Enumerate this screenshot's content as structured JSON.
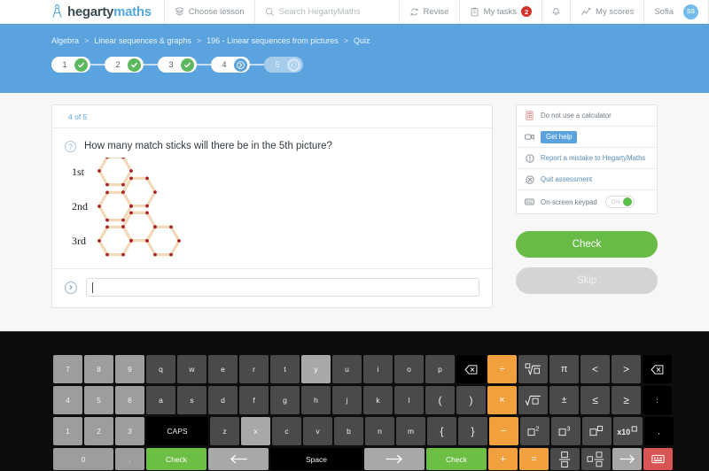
{
  "nav": {
    "logo_dark": "hegarty",
    "logo_blue": "maths",
    "choose_lesson": "Choose lesson",
    "search_placeholder": "Search HegartyMaths",
    "revise": "Revise",
    "my_tasks": "My tasks",
    "my_tasks_badge": "2",
    "my_scores": "My scores",
    "user_name": "Sofia",
    "user_initials": "SS"
  },
  "header": {
    "breadcrumb": [
      "Algebra",
      "Linear sequences & graphs",
      "196 - Linear sequences from pictures",
      "Quiz"
    ],
    "separator": ">",
    "steps": [
      {
        "num": "1",
        "state": "done"
      },
      {
        "num": "2",
        "state": "done"
      },
      {
        "num": "3",
        "state": "done"
      },
      {
        "num": "4",
        "state": "current"
      },
      {
        "num": "5",
        "state": "locked"
      }
    ]
  },
  "question": {
    "counter": "4 of 5",
    "text": "How many match sticks will there be in the 5th picture?",
    "figure_labels": [
      "1st",
      "2nd",
      "3rd"
    ],
    "answer_value": "",
    "answer_placeholder": ""
  },
  "panel": {
    "calculator": "Do not use a calculator",
    "get_help": "Get help",
    "report": "Report a mistake to HegartyMaths",
    "quit": "Quit assessment",
    "keypad": "On-screen keypad",
    "keypad_state": "ON"
  },
  "actions": {
    "check": "Check",
    "skip": "Skip"
  },
  "colors": {
    "brand_blue": "#5ba3de",
    "green": "#67bb46",
    "orange": "#f0a03c",
    "red": "#d95454"
  },
  "keyboard": {
    "row1": [
      "7",
      "8",
      "9",
      "q",
      "w",
      "e",
      "r",
      "t",
      "y",
      "u",
      "i",
      "o",
      "p",
      "⌫",
      "÷",
      "ⁿ√□",
      "π",
      "<",
      ">",
      "⌫"
    ],
    "row2": [
      "4",
      "5",
      "6",
      "a",
      "s",
      "d",
      "f",
      "g",
      "h",
      "j",
      "k",
      "l",
      "(",
      ")",
      "×",
      "√□",
      "±",
      "≤",
      "≥",
      ":"
    ],
    "row3": [
      "1",
      "2",
      "3",
      "CAPS",
      "z",
      "x",
      "c",
      "v",
      "b",
      "n",
      "m",
      "{",
      "}",
      "−",
      "□²",
      "□³",
      "□^□",
      "x10□",
      ","
    ],
    "row4": [
      "0",
      ".",
      "Check",
      "←",
      "Space",
      "→",
      "Check",
      "+",
      "=",
      "□/□",
      "□□/□",
      "→",
      "keyboard-hide"
    ]
  }
}
